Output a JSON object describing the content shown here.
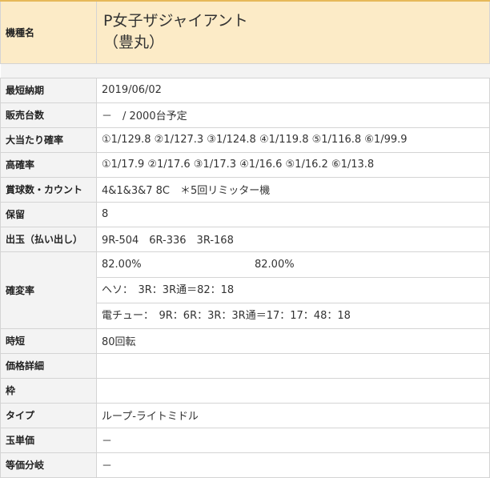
{
  "machine": {
    "label": "機種名",
    "name_line1": "P女子ザジャイアント",
    "name_line2": "（豊丸）"
  },
  "rows": [
    {
      "label": "最短納期",
      "value": "2019/06/02"
    },
    {
      "label": "販売台数",
      "value": "－　/ 2000台予定"
    },
    {
      "label": "大当たり確率",
      "value": "①1/129.8 ②1/127.3 ③1/124.8 ④1/119.8 ⑤1/116.8 ⑥1/99.9"
    },
    {
      "label": "高確率",
      "value": "①1/17.9 ②1/17.6 ③1/17.3 ④1/16.6 ⑤1/16.2 ⑥1/13.8"
    },
    {
      "label": "賞球数・カウント",
      "value": "4&1&3&7 8C　＊5回リミッター機"
    },
    {
      "label": "保留",
      "value": "8"
    },
    {
      "label": "出玉（払い出し）",
      "value": "9R-504　6R-336　3R-168"
    }
  ],
  "kakuhen": {
    "label": "確変率",
    "rate_a": "82.00%",
    "rate_b": "82.00%",
    "heso": "ヘソ：　3R：3R通＝82：18",
    "denchu": "電チュー：　9R：6R：3R：3R通＝17：17：48：18"
  },
  "rows2": [
    {
      "label": "時短",
      "value": "80回転"
    },
    {
      "label": "価格詳細",
      "value": ""
    },
    {
      "label": "枠",
      "value": ""
    },
    {
      "label": "タイプ",
      "value": "ループ-ライトミドル"
    },
    {
      "label": "玉単価",
      "value": "－"
    },
    {
      "label": "等価分岐",
      "value": "－"
    }
  ]
}
